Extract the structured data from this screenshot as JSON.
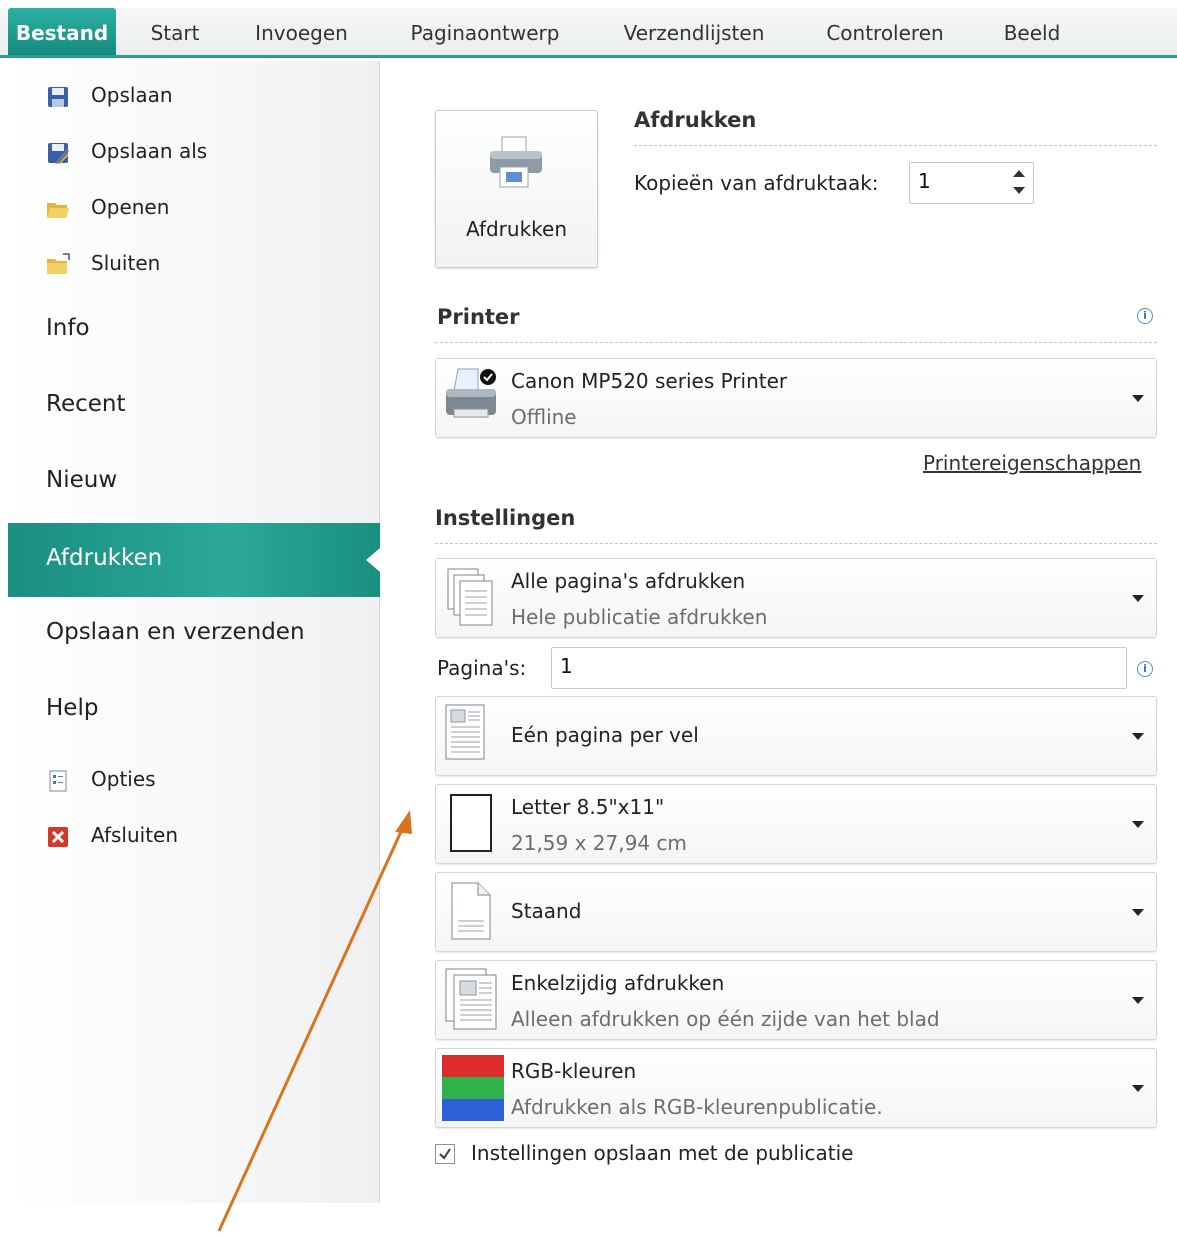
{
  "tabs": [
    "Bestand",
    "Start",
    "Invoegen",
    "Paginaontwerp",
    "Verzendlijsten",
    "Controleren",
    "Beeld"
  ],
  "nav": {
    "commands_top": [
      {
        "label": "Opslaan",
        "icon": "save-icon"
      },
      {
        "label": "Opslaan als",
        "icon": "save-as-icon"
      },
      {
        "label": "Openen",
        "icon": "open-folder-icon"
      },
      {
        "label": "Sluiten",
        "icon": "close-folder-icon"
      }
    ],
    "sections": [
      "Info",
      "Recent",
      "Nieuw",
      "Afdrukken",
      "Opslaan en verzenden",
      "Help"
    ],
    "active_section": "Afdrukken",
    "commands_bottom": [
      {
        "label": "Opties",
        "icon": "options-icon"
      },
      {
        "label": "Afsluiten",
        "icon": "exit-icon"
      }
    ]
  },
  "print": {
    "button_label": "Afdrukken",
    "heading": "Afdrukken",
    "copies_label": "Kopieën van afdruktaak:",
    "copies_value": "1"
  },
  "printer": {
    "heading": "Printer",
    "name": "Canon MP520 series Printer",
    "status": "Offline",
    "properties_link": "Printereigenschappen"
  },
  "settings": {
    "heading": "Instellingen",
    "pages_range": {
      "title": "Alle pagina's afdrukken",
      "subtitle": "Hele publicatie afdrukken"
    },
    "pages_label": "Pagina's:",
    "pages_value": "1",
    "layout": {
      "title": "Eén pagina per vel"
    },
    "paper": {
      "title": "Letter 8.5\"x11\"",
      "subtitle": "21,59 x 27,94 cm"
    },
    "orientation": {
      "title": "Staand"
    },
    "sides": {
      "title": "Enkelzijdig afdrukken",
      "subtitle": "Alleen afdrukken op één zijde van het blad"
    },
    "color": {
      "title": "RGB-kleuren",
      "subtitle": "Afdrukken als RGB-kleurenpublicatie."
    },
    "save_with_publication": {
      "label": "Instellingen opslaan met de publicatie",
      "checked": true
    }
  },
  "colors": {
    "accent": "#1a8f80",
    "annotation_arrow": "#d9731c"
  }
}
